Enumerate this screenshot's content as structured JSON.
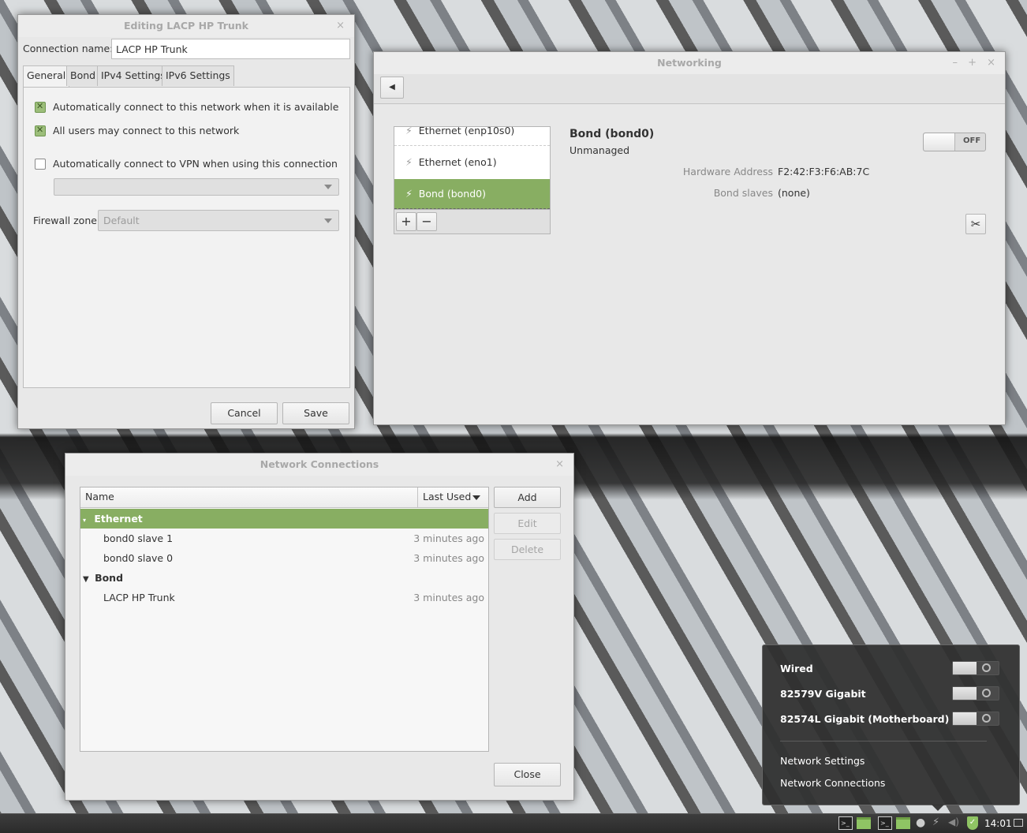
{
  "editor": {
    "title": "Editing LACP HP Trunk",
    "close": "×",
    "conn_label": "Connection name:",
    "conn_value": "LACP HP Trunk",
    "tabs": [
      "General",
      "Bond",
      "IPv4 Settings",
      "IPv6 Settings"
    ],
    "auto_connect": "Automatically connect to this network when it is available",
    "all_users": "All users may connect to this network",
    "vpn": "Automatically connect to VPN when using this connection",
    "firewall_label": "Firewall zone:",
    "firewall_value": "Default",
    "cancel": "Cancel",
    "save": "Save"
  },
  "networking": {
    "title": "Networking",
    "min": "–",
    "max": "+",
    "close": "×",
    "back": "◀",
    "devices": [
      "Ethernet (enp10s0)",
      "Ethernet (eno1)",
      "Bond (bond0)"
    ],
    "add": "+",
    "remove": "−",
    "device_name": "Bond (bond0)",
    "device_state": "Unmanaged",
    "toggle": "OFF",
    "hw_label": "Hardware Address",
    "hw_value": "F2:42:F3:F6:AB:7C",
    "slaves_label": "Bond slaves",
    "slaves_value": "(none)"
  },
  "connections": {
    "title": "Network Connections",
    "close": "×",
    "col_name": "Name",
    "col_used": "Last Used",
    "groups": [
      {
        "name": "Ethernet",
        "items": [
          {
            "name": "bond0 slave 1",
            "used": "3 minutes ago"
          },
          {
            "name": "bond0 slave 0",
            "used": "3 minutes ago"
          }
        ]
      },
      {
        "name": "Bond",
        "items": [
          {
            "name": "LACP HP Trunk",
            "used": "3 minutes ago"
          }
        ]
      }
    ],
    "add": "Add",
    "edit": "Edit",
    "delete": "Delete",
    "close_btn": "Close"
  },
  "tray": {
    "items": [
      "Wired",
      "82579V Gigabit",
      "82574L Gigabit (Motherboard)"
    ],
    "network_settings": "Network Settings",
    "network_connections": "Network Connections"
  },
  "taskbar": {
    "clock": "14:01"
  }
}
